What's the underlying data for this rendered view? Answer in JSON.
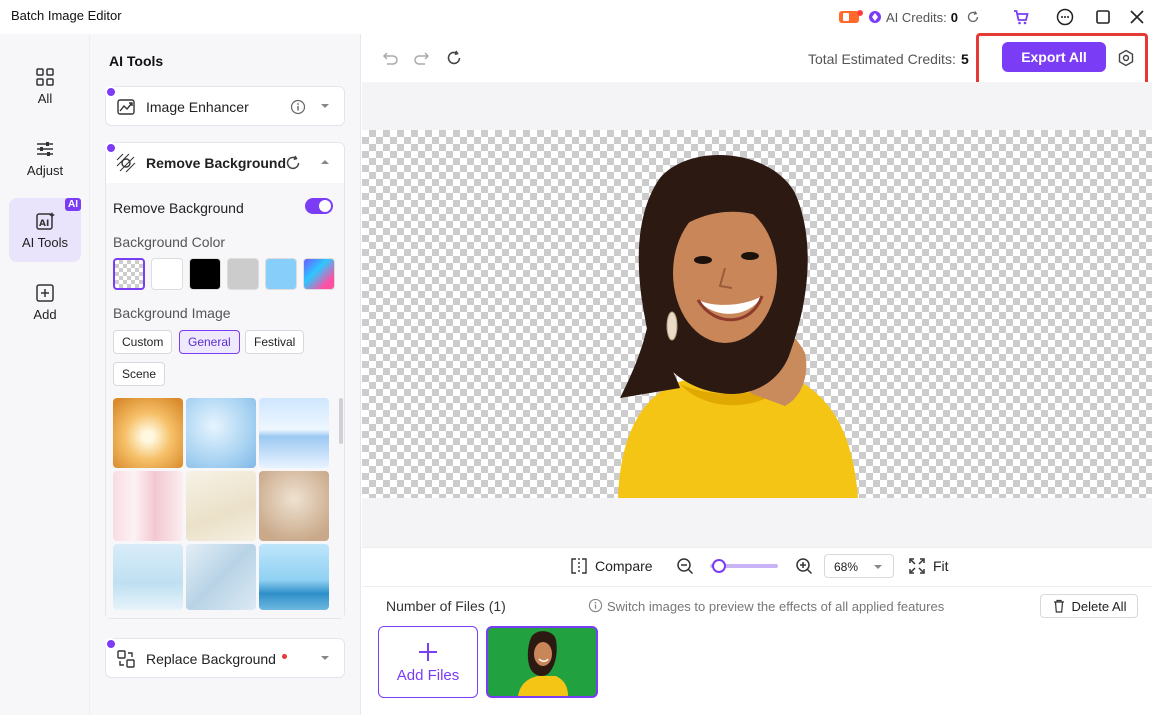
{
  "app": {
    "title": "Batch Image Editor"
  },
  "titlebar": {
    "credits_label": "AI Credits:",
    "credits_value": "0"
  },
  "rail": [
    {
      "label": "All"
    },
    {
      "label": "Adjust"
    },
    {
      "label": "AI Tools",
      "badge": "AI"
    },
    {
      "label": "Add"
    }
  ],
  "panel": {
    "title": "AI Tools",
    "image_enhancer": "Image Enhancer",
    "remove_bg": {
      "title": "Remove Background",
      "toggle_label": "Remove Background",
      "toggle_on": true,
      "color_label": "Background Color",
      "colors": [
        "transparent",
        "#ffffff",
        "#000000",
        "#cccccc",
        "#87cefa",
        "gradient"
      ],
      "image_label": "Background Image",
      "categories": [
        "Custom",
        "General",
        "Festival",
        "Scene"
      ],
      "selected_category": "General"
    },
    "replace_bg": "Replace Background"
  },
  "toolbar": {
    "estimate_label": "Total Estimated Credits:",
    "estimate_value": "5",
    "export_label": "Export All"
  },
  "zoom": {
    "compare_label": "Compare",
    "level": "68%",
    "fit_label": "Fit"
  },
  "files": {
    "count_label": "Number of Files (1)",
    "hint": "Switch images to preview the effects of all applied features",
    "delete_label": "Delete All",
    "add_label": "Add Files"
  },
  "colors": {
    "accent": "#7b3cf5",
    "highlight": "#e53935"
  }
}
